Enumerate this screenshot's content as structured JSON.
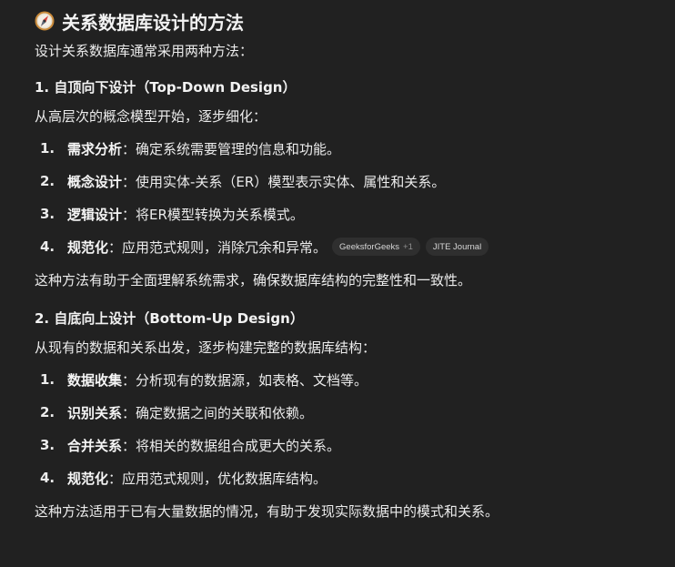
{
  "title": "关系数据库设计的方法",
  "title_icon": "compass-icon",
  "intro": "设计关系数据库通常采用两种方法：",
  "sections": [
    {
      "heading": "1. 自顶向下设计（Top-Down Design）",
      "lead": "从高层次的概念模型开始，逐步细化：",
      "steps": [
        {
          "num": "1.",
          "term": "需求分析",
          "desc": "：确定系统需要管理的信息和功能。"
        },
        {
          "num": "2.",
          "term": "概念设计",
          "desc": "：使用实体-关系（ER）模型表示实体、属性和关系。"
        },
        {
          "num": "3.",
          "term": "逻辑设计",
          "desc": "：将ER模型转换为关系模式。"
        },
        {
          "num": "4.",
          "term": "规范化",
          "desc": "：应用范式规则，消除冗余和异常。"
        }
      ],
      "sources": [
        {
          "label": "GeeksforGeeks",
          "extra": "+1"
        },
        {
          "label": "JITE Journal",
          "extra": ""
        }
      ],
      "summary": "这种方法有助于全面理解系统需求，确保数据库结构的完整性和一致性。"
    },
    {
      "heading": "2. 自底向上设计（Bottom-Up Design）",
      "lead": "从现有的数据和关系出发，逐步构建完整的数据库结构：",
      "steps": [
        {
          "num": "1.",
          "term": "数据收集",
          "desc": "：分析现有的数据源，如表格、文档等。"
        },
        {
          "num": "2.",
          "term": "识别关系",
          "desc": "：确定数据之间的关联和依赖。"
        },
        {
          "num": "3.",
          "term": "合并关系",
          "desc": "：将相关的数据组合成更大的关系。"
        },
        {
          "num": "4.",
          "term": "规范化",
          "desc": "：应用范式规则，优化数据库结构。"
        }
      ],
      "summary": "这种方法适用于已有大量数据的情况，有助于发现实际数据中的模式和关系。"
    }
  ]
}
